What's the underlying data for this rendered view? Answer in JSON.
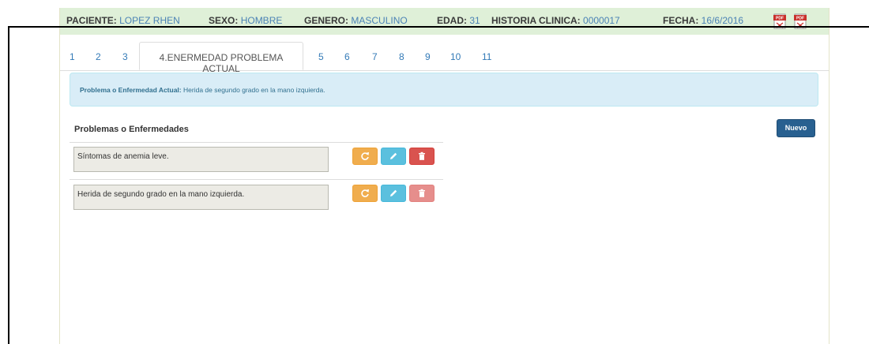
{
  "patient_bar": {
    "paciente_label": "PACIENTE:",
    "paciente_value": "LOPEZ RHEN",
    "sexo_label": "SEXO:",
    "sexo_value": "HOMBRE",
    "genero_label": "GENERO:",
    "genero_value": "MASCULINO",
    "edad_label": "EDAD:",
    "edad_value": "31",
    "historia_label": "HISTORIA CLINICA:",
    "historia_value": "0000017",
    "fecha_label": "FECHA:",
    "fecha_value": "16/6/2016",
    "pdf_text": "PDF"
  },
  "tabs": [
    "1",
    "2",
    "3",
    "4.ENERMEDAD PROBLEMA ACTUAL",
    "5",
    "6",
    "7",
    "8",
    "9",
    "10",
    "11"
  ],
  "alert": {
    "label": "Problema o Enfermedad Actual:",
    "text": "Herida de segundo grado en la mano izquierda."
  },
  "section": {
    "title": "Problemas o Enfermedades",
    "new_button": "Nuevo"
  },
  "problems": [
    {
      "text": "Síntomas de anemia leve."
    },
    {
      "text": "Herida de segundo grado en la mano izquierda."
    }
  ],
  "colors": {
    "patient_bar_bg": "#dff0d8",
    "alert_bg": "#d9edf7",
    "primary": "#286090",
    "warning": "#f0ad4e",
    "info": "#5bc0de",
    "danger": "#d9534f"
  },
  "icons": {
    "refresh": "refresh-icon",
    "edit": "pencil-icon",
    "delete": "trash-icon",
    "pdf": "pdf-icon"
  }
}
